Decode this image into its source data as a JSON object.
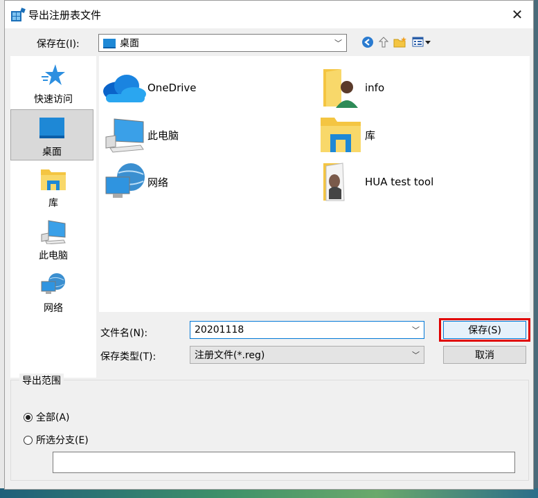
{
  "window": {
    "title": "导出注册表文件",
    "close_glyph": "✕"
  },
  "location": {
    "label": "保存在(I):",
    "value": "桌面"
  },
  "sidebar": {
    "items": [
      {
        "label": "快速访问",
        "icon": "star-icon"
      },
      {
        "label": "桌面",
        "icon": "desktop-icon",
        "selected": true
      },
      {
        "label": "库",
        "icon": "library-folder-icon"
      },
      {
        "label": "此电脑",
        "icon": "computer-icon"
      },
      {
        "label": "网络",
        "icon": "network-icon"
      }
    ]
  },
  "files": [
    {
      "name": "OneDrive",
      "icon": "onedrive-cloud-icon"
    },
    {
      "name": "info",
      "icon": "user-folder-icon"
    },
    {
      "name": "此电脑",
      "icon": "computer-icon"
    },
    {
      "name": "库",
      "icon": "library-folder-icon"
    },
    {
      "name": "网络",
      "icon": "network-icon"
    },
    {
      "name": "HUA test tool",
      "icon": "image-folder-icon"
    }
  ],
  "filename": {
    "label": "文件名(N):",
    "value": "20201118"
  },
  "filetype": {
    "label": "保存类型(T):",
    "value": "注册文件(*.reg)"
  },
  "buttons": {
    "save": "保存(S)",
    "cancel": "取消"
  },
  "export_range": {
    "title": "导出范围",
    "all_label": "全部(A)",
    "selected_label": "所选分支(E)",
    "selected_option": "all",
    "branch_value": ""
  },
  "colors": {
    "highlight": "#e00000",
    "accent": "#0078d7"
  }
}
